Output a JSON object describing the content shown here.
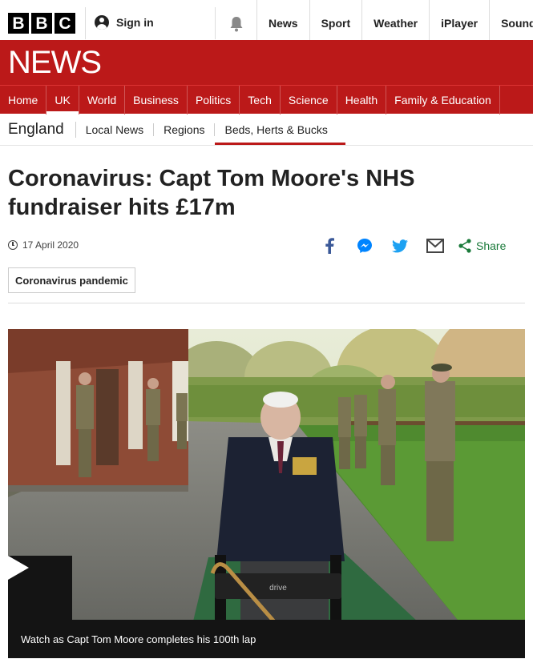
{
  "brand": {
    "logo_letters": [
      "B",
      "B",
      "C"
    ],
    "news_logo": "NEWS",
    "red": "#bb1919"
  },
  "top_bar": {
    "sign_in": "Sign in",
    "sign_in_icon": "user-icon",
    "notifications_icon": "bell-icon",
    "links": [
      "News",
      "Sport",
      "Weather",
      "iPlayer",
      "Sounds"
    ]
  },
  "main_nav": {
    "items": [
      "Home",
      "UK",
      "World",
      "Business",
      "Politics",
      "Tech",
      "Science",
      "Health",
      "Family & Education"
    ],
    "active": "UK"
  },
  "sub_nav": {
    "title": "England",
    "items": [
      "Local News",
      "Regions",
      "Beds, Herts & Bucks"
    ],
    "active": "Beds, Herts & Bucks"
  },
  "article": {
    "headline": "Coronavirus: Capt Tom Moore's NHS fundraiser hits £17m",
    "date": "17 April 2020",
    "share_label": "Share",
    "share_icons": [
      "facebook-icon",
      "messenger-icon",
      "twitter-icon",
      "email-icon",
      "share-icon"
    ],
    "tag": "Coronavirus pandemic"
  },
  "video": {
    "caption": "Watch as Capt Tom Moore completes his 100th lap",
    "walker_label": "drive"
  }
}
